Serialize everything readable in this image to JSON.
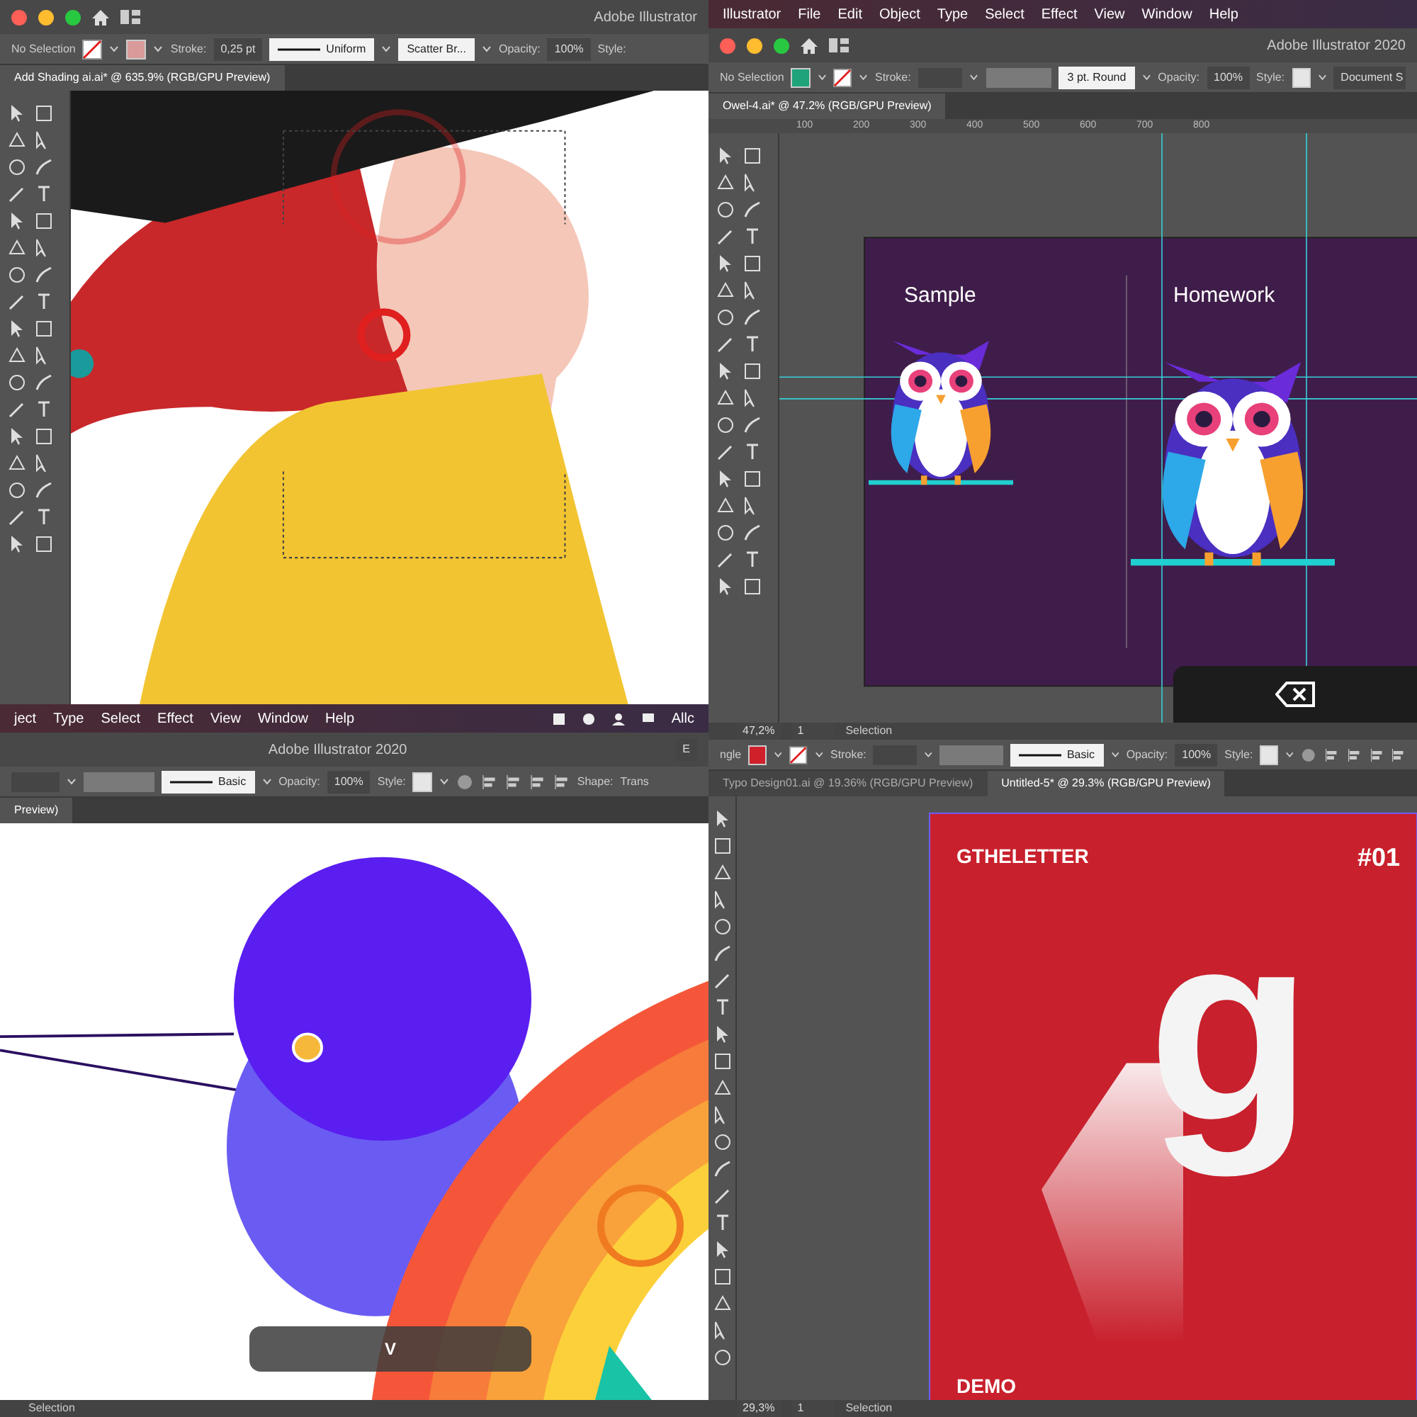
{
  "panels": [
    {
      "traffic_lights": true,
      "title": "Adobe Illustrator",
      "controls": [
        {
          "kind": "label",
          "text": "No Selection"
        },
        {
          "kind": "none-swatch"
        },
        {
          "kind": "swatch",
          "color": "#d99a9a"
        },
        {
          "kind": "label",
          "text": "Stroke:"
        },
        {
          "kind": "field",
          "text": "0,25 pt"
        },
        {
          "kind": "stroke-line",
          "text": "Uniform"
        },
        {
          "kind": "white-box",
          "text": "Scatter Br..."
        },
        {
          "kind": "label",
          "text": "Opacity:"
        },
        {
          "kind": "field",
          "text": "100%"
        },
        {
          "kind": "label",
          "text": "Style:"
        }
      ],
      "tabs": [
        {
          "label": "Add Shading ai.ai* @ 635.9% (RGB/GPU Preview)",
          "selected": true
        }
      ],
      "tool_panel": {
        "kind": "double"
      },
      "canvas": {
        "kind": "portrait"
      }
    },
    {
      "menu": [
        "Illustrator",
        "File",
        "Edit",
        "Object",
        "Type",
        "Select",
        "Effect",
        "View",
        "Window",
        "Help"
      ],
      "traffic_lights": true,
      "title": "Adobe Illustrator 2020",
      "controls": [
        {
          "kind": "label",
          "text": "No Selection"
        },
        {
          "kind": "swatch",
          "color": "#1fa37a"
        },
        {
          "kind": "none-swatch"
        },
        {
          "kind": "label",
          "text": "Stroke:"
        },
        {
          "kind": "blank-field"
        },
        {
          "kind": "blank-box"
        },
        {
          "kind": "white-box",
          "text": "3 pt. Round"
        },
        {
          "kind": "label",
          "text": "Opacity:"
        },
        {
          "kind": "field",
          "text": "100%"
        },
        {
          "kind": "label",
          "text": "Style:"
        },
        {
          "kind": "swatch",
          "color": "#e6e6e6"
        },
        {
          "kind": "field",
          "text": "Document S"
        }
      ],
      "tabs": [
        {
          "label": "Owel-4.ai* @ 47.2% (RGB/GPU Preview)",
          "selected": true
        }
      ],
      "tool_panel": {
        "kind": "double"
      },
      "ruler": [
        "100",
        "200",
        "300",
        "400",
        "500",
        "600",
        "700",
        "800"
      ],
      "canvas": {
        "kind": "owls",
        "labels": [
          "Sample",
          "Homework"
        ]
      },
      "key_overlay": {
        "kind": "backspace"
      },
      "status": [
        {
          "kind": "field",
          "text": "47,2%"
        },
        {
          "kind": "field",
          "text": "1"
        },
        {
          "kind": "label",
          "text": "Selection"
        }
      ]
    },
    {
      "menu": [
        "ject",
        "Type",
        "Select",
        "Effect",
        "View",
        "Window",
        "Help"
      ],
      "menu_right": "Allc",
      "traffic_lights": false,
      "title": "Adobe Illustrator 2020",
      "title_right": "E",
      "controls": [
        {
          "kind": "blank-field"
        },
        {
          "kind": "blank-box"
        },
        {
          "kind": "stroke-line",
          "text": "Basic"
        },
        {
          "kind": "label",
          "text": "Opacity:"
        },
        {
          "kind": "field",
          "text": "100%"
        },
        {
          "kind": "label",
          "text": "Style:"
        },
        {
          "kind": "swatch",
          "color": "#e6e6e6"
        },
        {
          "kind": "align-icons"
        },
        {
          "kind": "label",
          "text": "Shape:"
        },
        {
          "kind": "label",
          "text": "Trans"
        }
      ],
      "tabs": [
        {
          "label": "Preview)",
          "selected": true
        }
      ],
      "canvas": {
        "kind": "planet"
      },
      "key_overlay": {
        "kind": "letter",
        "text": "V"
      },
      "status": [
        {
          "kind": "label",
          "text": "Selection"
        }
      ]
    },
    {
      "controls": [
        {
          "kind": "label",
          "text": "ngle"
        },
        {
          "kind": "swatch",
          "color": "#d0202a"
        },
        {
          "kind": "none-swatch"
        },
        {
          "kind": "label",
          "text": "Stroke:"
        },
        {
          "kind": "blank-field"
        },
        {
          "kind": "blank-box"
        },
        {
          "kind": "stroke-line",
          "text": "Basic"
        },
        {
          "kind": "label",
          "text": "Opacity:"
        },
        {
          "kind": "field",
          "text": "100%"
        },
        {
          "kind": "label",
          "text": "Style:"
        },
        {
          "kind": "swatch",
          "color": "#e6e6e6"
        },
        {
          "kind": "align-icons"
        }
      ],
      "tabs": [
        {
          "label": "Typo Design01.ai @ 19.36% (RGB/GPU Preview)",
          "selected": false
        },
        {
          "label": "Untitled-5* @ 29.3% (RGB/GPU Preview)",
          "selected": true
        }
      ],
      "tool_panel": {
        "kind": "single"
      },
      "canvas": {
        "kind": "poster",
        "title": "GTHELETTER",
        "number": "#01",
        "letter": "g",
        "footer": "DEMO"
      },
      "status": [
        {
          "kind": "field",
          "text": "29,3%"
        },
        {
          "kind": "field",
          "text": "1"
        },
        {
          "kind": "label",
          "text": "Selection"
        }
      ]
    }
  ]
}
